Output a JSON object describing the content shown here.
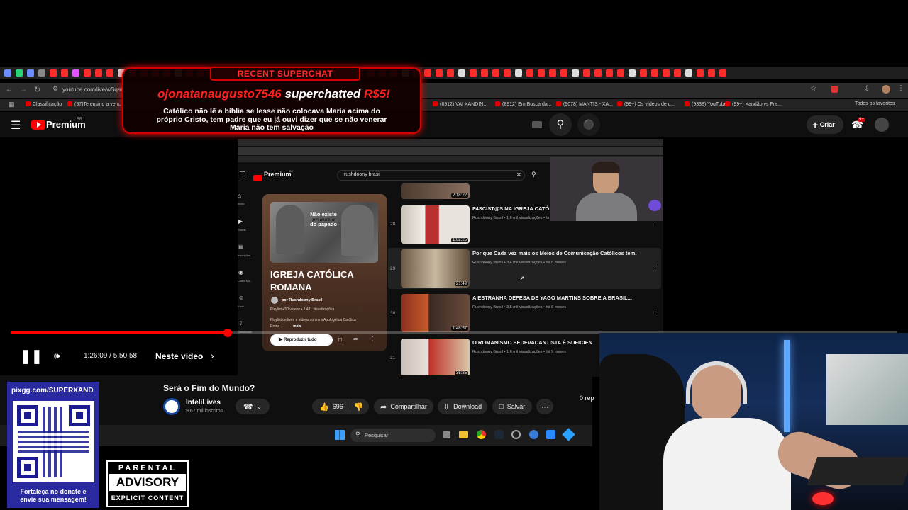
{
  "browser": {
    "url": "youtube.com/live/wSqan",
    "bookmarks": [
      "Classificação",
      "(97)Te ensino a venc...",
      "(8912) VAI XANDIN...",
      "(8912) Em Busca da...",
      "(9078) MANTIS - XA...",
      "(99+) Os vídeos de c...",
      "(9338) YouTube",
      "(99+) Xandão vs Fra..."
    ],
    "all_favorites": "Todos os favoritos"
  },
  "yt": {
    "brand": "Premium",
    "brand_sup": "BR",
    "create_label": "Criar",
    "notif_count": "9+"
  },
  "inner": {
    "search_query": "rushdoony brasil",
    "brand": "Premium",
    "brand_sup": "BR",
    "sidebar": [
      "Início",
      "Shorts",
      "Inscrições",
      "Você",
      "Downloads"
    ],
    "sidebar_partial": [
      "Clube Mu..."
    ],
    "playlist": {
      "badge_line1": "Não existe",
      "badge_line2": "primazia",
      "badge_line3": "do papado",
      "title_line1": "IGREJA CATÓLICA",
      "title_line2": "ROMANA",
      "author": "por Rushdoony Brasil",
      "meta": "Playlist • 50 vídeos • 2.431 visualizações",
      "desc_line1": "Playlist de lives e vídeos contra a Apologética Católica",
      "desc_line2": "Roma...",
      "more": "...mais",
      "play_all": "Reproduzir tudo"
    },
    "videos": [
      {
        "num": "",
        "title": "",
        "meta": "",
        "duration": "2:18:22"
      },
      {
        "num": "28",
        "title": "F4SCIST@S NA IGREJA CATÓL",
        "meta": "Rushdoony Brasil • 1,6 mil visualizações • há",
        "duration": "1:02:25"
      },
      {
        "num": "29",
        "title": "Por que Cada vez mais os Meios de Comunicação Católicos tem...",
        "meta": "Rushdoony Brasil • 3,4 mil visualizações • há 8 meses",
        "duration": "21:49"
      },
      {
        "num": "30",
        "title": "A ESTRANHA DEFESA DE YAGO MARTINS SOBRE A BRASIL...",
        "meta": "Rushdoony Brasil • 3,5 mil visualizações • há 8 meses",
        "duration": "1:48:57"
      },
      {
        "num": "31",
        "title": "O ROMANISMO SEDEVACANTISTA É SUFICIENT",
        "meta": "Rushdoony Brasil • 1,6 mil visualizações • há 9 meses",
        "duration": "35:35"
      }
    ]
  },
  "player": {
    "time": "1:26:09 / 5:50:58",
    "chapter": "Neste vídeo",
    "progress_fraction": 0.2447
  },
  "video": {
    "title": "Será o Fim do Mundo?",
    "channel": "InteliLives",
    "subs": "9,67 mil inscritos",
    "likes": "696",
    "share": "Compartilhar",
    "download": "Download",
    "save": "Salvar",
    "replies_partial": "0 rep"
  },
  "taskbar": {
    "search": "Pesquisar"
  },
  "superchat": {
    "header": "RECENT SUPERCHAT",
    "user": "ojonatanaugusto7546",
    "action": "superchatted",
    "amount": "R$5!",
    "message_line1": "Católico não lê a bíblia se lesse não colocava Maria acima do",
    "message_line2": "próprio Cristo, tem padre que eu já ouvi dizer que se não venerar",
    "message_line3": "Maria não tem salvação"
  },
  "donation": {
    "link": "pixgg.com/SUPERXAND",
    "cta_line1": "Fortaleça no donate e",
    "cta_line2": "envie sua mensagem!"
  },
  "advisory": {
    "line1": "PARENTAL",
    "line2": "ADVISORY",
    "line3": "EXPLICIT CONTENT"
  },
  "colors": {
    "yt_red": "#ff0000",
    "superchat_red": "#d40000",
    "qr_blue": "#2a2aa0"
  }
}
